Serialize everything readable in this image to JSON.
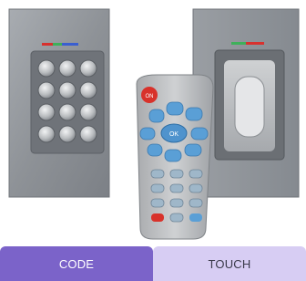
{
  "tabs": [
    {
      "label": "CODE",
      "active": true
    },
    {
      "label": "TOUCH",
      "active": false
    }
  ],
  "remote": {
    "keys_top": [
      "OK",
      "M",
      "F1",
      "C",
      "OK",
      "US",
      "SET",
      "SET",
      "R2"
    ],
    "power_label": "ON"
  },
  "colors": {
    "tab_active": "#7b63c9",
    "tab_inactive": "#d7cdf3",
    "panel_steel": "#8f9398",
    "remote_blue": "#5a9fd6",
    "remote_red": "#d8322b"
  }
}
